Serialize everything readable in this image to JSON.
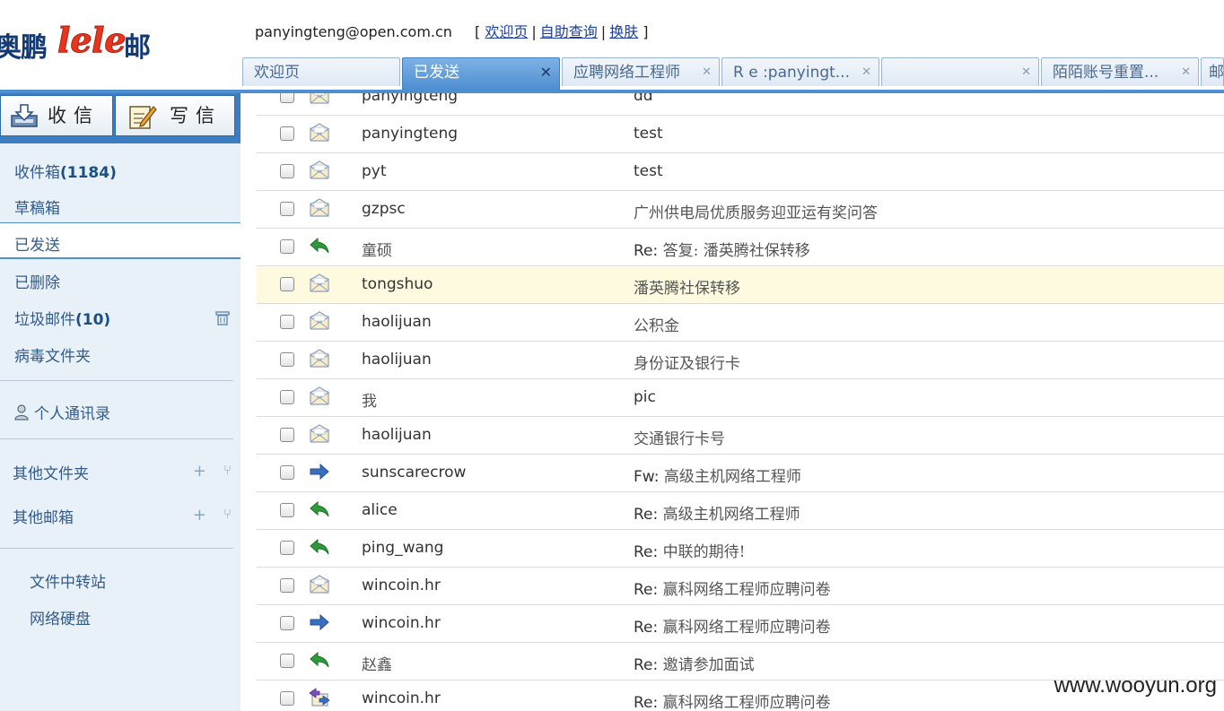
{
  "brand": {
    "text_left": "奥鹏",
    "le1": "le",
    "le2": "le",
    "text_right": "邮",
    "accent": "#e8361e",
    "navy": "#143a75"
  },
  "userbar": {
    "email": "panyingteng@open.com.cn",
    "open": "[",
    "welcome": "欢迎页",
    "sep1": "|",
    "selfquery": "自助查询",
    "sep2": "|",
    "skin": "换肤",
    "close": "]"
  },
  "tabs": [
    {
      "label": "欢迎页",
      "close": ""
    },
    {
      "label": "已发送",
      "close": "✕"
    },
    {
      "label": "应聘网络工程师",
      "close": "✕"
    },
    {
      "label": "R e :panyingt...",
      "close": "✕"
    },
    {
      "label": "",
      "close": "✕"
    },
    {
      "label": "陌陌账号重置...",
      "close": "✕"
    },
    {
      "label": "邮",
      "close": ""
    }
  ],
  "actions": {
    "receive": "收信",
    "write": "写信"
  },
  "folders": {
    "inbox": "收件箱",
    "inbox_count": "(1184)",
    "drafts": "草稿箱",
    "sent": "已发送",
    "deleted": "已删除",
    "spam": "垃圾邮件",
    "spam_count": "(10)",
    "virus": "病毒文件夹",
    "contacts": "个人通讯录",
    "other_folders": "其他文件夹",
    "other_mailboxes": "其他邮箱",
    "transfer": "文件中转站",
    "netdisk": "网络硬盘",
    "plus": "+",
    "fork": "⑂"
  },
  "mails": [
    {
      "sender": "panyingteng",
      "subject": "dd",
      "icon": "envelope-icon"
    },
    {
      "sender": "panyingteng",
      "subject": "test",
      "icon": "envelope-icon"
    },
    {
      "sender": "pyt",
      "subject": "test",
      "icon": "envelope-icon"
    },
    {
      "sender": "gzpsc",
      "subject": "广州供电局优质服务迎亚运有奖问答",
      "icon": "envelope-icon"
    },
    {
      "sender": "童硕",
      "subject": "Re: 答复: 潘英腾社保转移",
      "icon": "reply-icon"
    },
    {
      "sender": "tongshuo",
      "subject": "潘英腾社保转移",
      "icon": "envelope-icon"
    },
    {
      "sender": "haolijuan",
      "subject": "公积金",
      "icon": "envelope-icon"
    },
    {
      "sender": "haolijuan",
      "subject": "身份证及银行卡",
      "icon": "envelope-icon"
    },
    {
      "sender": "我",
      "subject": "pic",
      "icon": "envelope-icon"
    },
    {
      "sender": "haolijuan",
      "subject": "交通银行卡号",
      "icon": "envelope-icon"
    },
    {
      "sender": "sunscarecrow",
      "subject": "Fw: 高级主机网络工程师",
      "icon": "forward-icon"
    },
    {
      "sender": "alice",
      "subject": "Re: 高级主机网络工程师",
      "icon": "reply-icon"
    },
    {
      "sender": "ping_wang",
      "subject": "Re: 中联的期待!",
      "icon": "reply-icon"
    },
    {
      "sender": "wincoin.hr",
      "subject": "Re: 赢科网络工程师应聘问卷",
      "icon": "envelope-icon"
    },
    {
      "sender": "wincoin.hr",
      "subject": "Re: 赢科网络工程师应聘问卷",
      "icon": "forward-icon"
    },
    {
      "sender": "赵鑫",
      "subject": "Re: 邀请参加面试",
      "icon": "reply-icon"
    },
    {
      "sender": "wincoin.hr",
      "subject": "Re: 赢科网络工程师应聘问卷",
      "icon": "reply-forward-icon"
    }
  ],
  "watermark": "www.wooyun.org",
  "colors": {
    "tab_active": "#4d8fd1",
    "row_highlight": "#fdfae0",
    "sidebar_bg": "#e8f0f8",
    "reply_green": "#2f9a3a",
    "forward_blue": "#3a6fc0"
  }
}
